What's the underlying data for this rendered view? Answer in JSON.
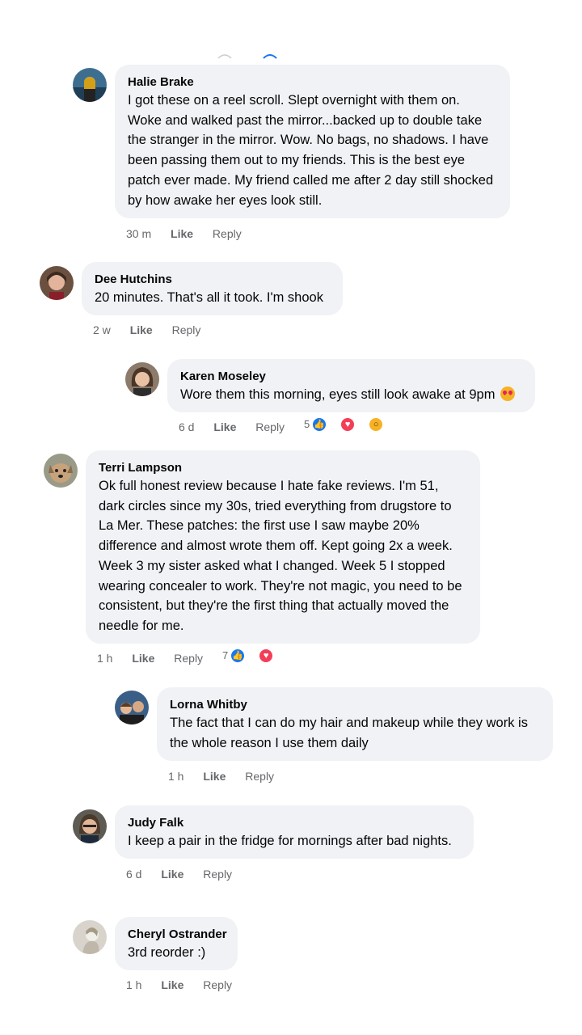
{
  "comments": [
    {
      "name": "Halie Brake",
      "text": "I got these on a reel scroll. Slept overnight with them on. Woke and walked past the mirror...backed up to double take the stranger in the mirror. Wow. No bags, no shadows. I have been passing them out to my friends. This is the best eye patch ever made. My friend called me after 2 day still shocked by how awake her eyes look still.",
      "time": "30 m",
      "like": "Like",
      "reply": "Reply"
    },
    {
      "name": "Dee Hutchins",
      "text": "20 minutes. That's all it took. I'm shook",
      "time": "2 w",
      "like": "Like",
      "reply": "Reply"
    },
    {
      "name": "Karen Moseley",
      "text": "Wore them this morning, eyes still look awake at 9pm",
      "time": "6 d",
      "like": "Like",
      "reply": "Reply",
      "reaction_count": "5"
    },
    {
      "name": "Terri Lampson",
      "text": "Ok full honest review because I hate fake reviews. I'm 51, dark circles since my 30s, tried everything from drugstore to La Mer. These patches: the first use I saw maybe 20% difference and almost wrote them off. Kept going 2x a week. Week 3 my sister asked what I changed. Week 5 I stopped wearing concealer to work. They're not magic, you need to be consistent, but they're the first thing that actually moved the needle for me.",
      "time": "1 h",
      "like": "Like",
      "reply": "Reply",
      "reaction_count": "7"
    },
    {
      "name": "Lorna Whitby",
      "text": "The fact that I can do my hair and makeup while they work is the whole reason I use them daily",
      "time": "1 h",
      "like": "Like",
      "reply": "Reply"
    },
    {
      "name": "Judy Falk",
      "text": "I keep a pair in the fridge for mornings after bad nights.",
      "time": "6 d",
      "like": "Like",
      "reply": "Reply"
    },
    {
      "name": "Cheryl Ostrander",
      "text": "3rd reorder :)",
      "time": "1 h",
      "like": "Like",
      "reply": "Reply"
    }
  ],
  "colors": {
    "bubble": "#f0f2f5",
    "meta": "#65676b",
    "like_reaction": "#1877f2",
    "love_reaction": "#f33e58",
    "wow_reaction": "#f7b125"
  },
  "icons": [
    "avatar-photo",
    "heart-eyes-emoji",
    "like-reaction-icon",
    "love-reaction-icon",
    "wow-reaction-icon"
  ]
}
